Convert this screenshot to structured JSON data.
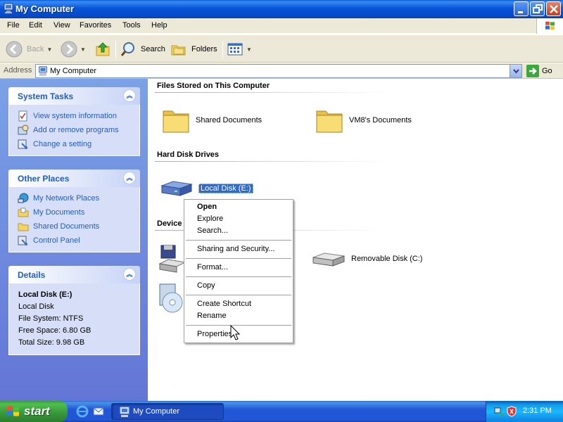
{
  "window": {
    "title": "My Computer"
  },
  "menubar": {
    "items": [
      "File",
      "Edit",
      "View",
      "Favorites",
      "Tools",
      "Help"
    ]
  },
  "toolbar": {
    "back_label": "Back",
    "search_label": "Search",
    "folders_label": "Folders"
  },
  "address": {
    "label": "Address",
    "value": "My Computer",
    "go_label": "Go"
  },
  "left": {
    "system_tasks": {
      "title": "System Tasks",
      "items": [
        "View system information",
        "Add or remove programs",
        "Change a setting"
      ]
    },
    "other_places": {
      "title": "Other Places",
      "items": [
        "My Network Places",
        "My Documents",
        "Shared Documents",
        "Control Panel"
      ]
    },
    "details": {
      "title": "Details",
      "name": "Local Disk (E:)",
      "type": "Local Disk",
      "filesystem": "File System: NTFS",
      "free": "Free Space: 6.80 GB",
      "total": "Total Size: 9.98 GB"
    }
  },
  "main": {
    "groups": {
      "files": "Files Stored on This Computer",
      "hdd": "Hard Disk Drives",
      "devices": "Device"
    },
    "items": {
      "shared_docs": "Shared Documents",
      "vm8_docs": "VM8's Documents",
      "local_disk": "Local Disk (E:)",
      "removable": "Removable Disk (C:)"
    }
  },
  "context_menu": {
    "items": [
      "Open",
      "Explore",
      "Search...",
      "Sharing and Security...",
      "Format...",
      "Copy",
      "Create Shortcut",
      "Rename",
      "Properties"
    ]
  },
  "taskbar": {
    "start_label": "start",
    "task_label": "My Computer",
    "clock": "2:31 PM"
  },
  "colors": {
    "title_blue": "#0854d8",
    "link_blue": "#215dc6",
    "selection": "#316ac5",
    "start_green": "#36963a"
  },
  "icons": {
    "folder": "folder-icon",
    "drive": "hard-drive-icon",
    "removable": "removable-disk-icon"
  }
}
